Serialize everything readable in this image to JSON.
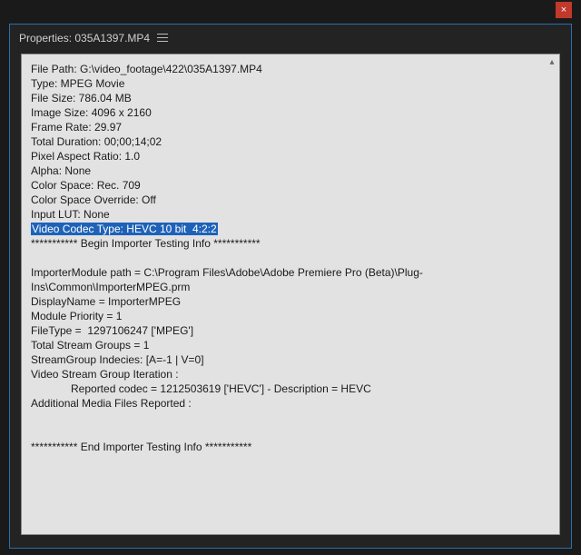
{
  "titlebar": {
    "close_label": "×"
  },
  "panel": {
    "title": "Properties: 035A1397.MP4"
  },
  "properties": {
    "lines_before_highlight": [
      "File Path: G:\\video_footage\\422\\035A1397.MP4",
      "Type: MPEG Movie",
      "File Size: 786.04 MB",
      "Image Size: 4096 x 2160",
      "Frame Rate: 29.97",
      "Total Duration: 00;00;14;02",
      "Pixel Aspect Ratio: 1.0",
      "Alpha: None",
      "Color Space: Rec. 709",
      "Color Space Override: Off",
      "Input LUT: None"
    ],
    "highlighted_line": "Video Codec Type: HEVC 10 bit  4:2:2",
    "lines_after_highlight_block1": [
      "*********** Begin Importer Testing Info ***********",
      "",
      "ImporterModule path = C:\\Program Files\\Adobe\\Adobe Premiere Pro (Beta)\\Plug-Ins\\Common\\ImporterMPEG.prm",
      "DisplayName = ImporterMPEG",
      "Module Priority = 1",
      "FileType =  1297106247 ['MPEG']",
      "Total Stream Groups = 1",
      "StreamGroup Indecies: [A=-1 | V=0]",
      "Video Stream Group Iteration :"
    ],
    "indented_line": "Reported codec = 1212503619 ['HEVC'] - Description = HEVC",
    "lines_after_highlight_block2": [
      "Additional Media Files Reported :",
      "",
      "",
      "*********** End Importer Testing Info ***********"
    ]
  }
}
